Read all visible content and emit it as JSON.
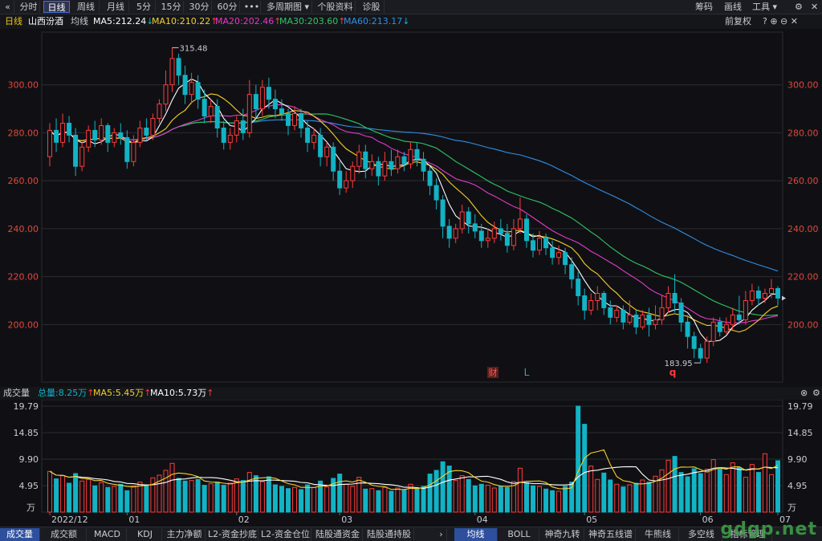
{
  "toolbar": {
    "back_icon": "«",
    "tabs": [
      "分时",
      "日线",
      "周线",
      "月线",
      "5分",
      "15分",
      "30分",
      "60分",
      "•••",
      "多周期图 ▾",
      "个股资料",
      "诊股"
    ],
    "active_tab": "日线",
    "right": [
      "筹码",
      "画线",
      "工具 ▾"
    ],
    "settings_icon": "⚙"
  },
  "info": {
    "period": "日线",
    "stock_name": "山西汾酒",
    "ma_label": "均线",
    "ma5": "MA5:212.24",
    "ma10": "MA10:210.22",
    "ma20": "MA20:202.46",
    "ma30": "MA30:203.60",
    "ma60": "MA60:213.17",
    "fuquan": "前复权",
    "ma5_arrow": "↓",
    "ma10_arrow": "↑",
    "ma20_arrow": "↑",
    "ma30_arrow": "↑",
    "ma60_arrow": "↓"
  },
  "volume_header": {
    "title": "成交量",
    "total": "总量:8.25万",
    "ma5": "MA5:5.45万",
    "ma10": "MA10:5.73万"
  },
  "bottom_tabs": {
    "left": [
      "成交量",
      "成交额",
      "MACD",
      "KDJ",
      "主力净额",
      "L2-资金抄底",
      "L2-资金仓位",
      "陆股通资金",
      "陆股通持股"
    ],
    "right": [
      "均线",
      "BOLL",
      "神奇九转",
      "神奇五线谱",
      "牛熊线",
      "多空线",
      "指标管理"
    ],
    "active_left": "成交量",
    "active_right": "均线"
  },
  "colors": {
    "up": "#ff3b3b",
    "down": "#12b3c4",
    "ma5": "#ffffff",
    "ma10": "#f5d02c",
    "ma20": "#e13bc8",
    "ma30": "#2ec764",
    "ma60": "#2f8fe6"
  },
  "markers": {
    "high_label": "315.48",
    "low_label": "183.95",
    "event_cai": "财",
    "event_l": "L",
    "event_q": "q"
  },
  "watermark": "gdgp.net",
  "chart_data": {
    "type": "candlestick",
    "title": "山西汾酒 日线",
    "price_axis": {
      "ticks": [
        200,
        220,
        240,
        260,
        280,
        300
      ],
      "tick_labels": [
        "200.00",
        "220.00",
        "240.00",
        "260.00",
        "280.00",
        "300.00"
      ],
      "ylim": [
        176,
        322
      ]
    },
    "date_axis": {
      "labels": [
        "2022/12",
        "01",
        "02",
        "03",
        "04",
        "05",
        "06",
        "07"
      ]
    },
    "volume_axis": {
      "unit": "万",
      "ticks": [
        4.95,
        9.9,
        14.85,
        19.79
      ],
      "tick_labels": [
        "4.95",
        "9.90",
        "14.85",
        "19.79"
      ],
      "ylim": [
        0,
        19.79
      ]
    },
    "candles": [
      [
        270,
        281,
        266,
        284
      ],
      [
        281,
        276,
        272,
        286
      ],
      [
        276,
        284,
        274,
        288
      ],
      [
        284,
        279,
        276,
        287
      ],
      [
        279,
        266,
        262,
        282
      ],
      [
        266,
        274,
        264,
        276
      ],
      [
        274,
        281,
        272,
        283
      ],
      [
        281,
        277,
        274,
        285
      ],
      [
        277,
        283,
        275,
        286
      ],
      [
        283,
        276,
        272,
        284
      ],
      [
        276,
        280,
        274,
        282
      ],
      [
        280,
        278,
        275,
        284
      ],
      [
        278,
        268,
        265,
        281
      ],
      [
        268,
        276,
        266,
        279
      ],
      [
        276,
        282,
        274,
        285
      ],
      [
        282,
        279,
        277,
        286
      ],
      [
        279,
        286,
        277,
        288
      ],
      [
        286,
        292,
        284,
        294
      ],
      [
        292,
        300,
        289,
        306
      ],
      [
        300,
        311,
        297,
        315.5
      ],
      [
        311,
        304,
        300,
        313
      ],
      [
        304,
        296,
        292,
        308
      ],
      [
        296,
        301,
        292,
        305
      ],
      [
        301,
        294,
        290,
        304
      ],
      [
        294,
        287,
        284,
        298
      ],
      [
        287,
        291,
        284,
        294
      ],
      [
        291,
        282,
        278,
        294
      ],
      [
        282,
        276,
        273,
        285
      ],
      [
        276,
        279,
        273,
        282
      ],
      [
        279,
        285,
        276,
        287
      ],
      [
        285,
        280,
        277,
        290
      ],
      [
        280,
        296,
        278,
        302
      ],
      [
        296,
        290,
        286,
        300
      ],
      [
        290,
        299,
        287,
        302
      ],
      [
        299,
        294,
        290,
        303
      ],
      [
        294,
        290,
        286,
        298
      ],
      [
        290,
        288,
        285,
        294
      ],
      [
        288,
        283,
        279,
        290
      ],
      [
        283,
        288,
        281,
        291
      ],
      [
        288,
        282,
        278,
        290
      ],
      [
        282,
        276,
        272,
        285
      ],
      [
        276,
        279,
        273,
        282
      ],
      [
        279,
        270,
        266,
        282
      ],
      [
        270,
        274,
        266,
        276
      ],
      [
        274,
        264,
        260,
        276
      ],
      [
        264,
        257,
        254,
        268
      ],
      [
        257,
        260,
        255,
        264
      ],
      [
        260,
        266,
        257,
        268
      ],
      [
        266,
        272,
        263,
        275
      ],
      [
        272,
        265,
        261,
        275
      ],
      [
        265,
        268,
        262,
        271
      ],
      [
        268,
        262,
        258,
        270
      ],
      [
        262,
        268,
        260,
        272
      ],
      [
        268,
        265,
        262,
        273
      ],
      [
        265,
        270,
        263,
        273
      ],
      [
        270,
        267,
        264,
        272
      ],
      [
        267,
        273,
        265,
        276
      ],
      [
        273,
        269,
        266,
        276
      ],
      [
        269,
        264,
        260,
        272
      ],
      [
        264,
        258,
        254,
        266
      ],
      [
        258,
        252,
        248,
        261
      ],
      [
        252,
        241,
        236,
        254
      ],
      [
        241,
        236,
        232,
        244
      ],
      [
        236,
        240,
        234,
        242
      ],
      [
        240,
        247,
        238,
        250
      ],
      [
        247,
        242,
        238,
        249
      ],
      [
        242,
        239,
        236,
        246
      ],
      [
        239,
        235,
        232,
        242
      ],
      [
        235,
        236,
        232,
        240
      ],
      [
        236,
        240,
        234,
        243
      ],
      [
        240,
        238,
        235,
        244
      ],
      [
        238,
        233,
        230,
        242
      ],
      [
        233,
        240,
        231,
        244
      ],
      [
        240,
        244,
        238,
        253
      ],
      [
        244,
        235,
        232,
        246
      ],
      [
        235,
        231,
        228,
        238
      ],
      [
        231,
        236,
        229,
        239
      ],
      [
        236,
        232,
        229,
        238
      ],
      [
        232,
        228,
        225,
        235
      ],
      [
        228,
        230,
        225,
        233
      ],
      [
        230,
        225,
        221,
        232
      ],
      [
        225,
        219,
        215,
        228
      ],
      [
        219,
        212,
        208,
        222
      ],
      [
        212,
        206,
        202,
        215
      ],
      [
        206,
        210,
        204,
        213
      ],
      [
        210,
        213,
        206,
        216
      ],
      [
        213,
        207,
        204,
        214
      ],
      [
        207,
        203,
        200,
        210
      ],
      [
        203,
        206,
        201,
        208
      ],
      [
        206,
        201,
        198,
        208
      ],
      [
        201,
        204,
        200,
        210
      ],
      [
        204,
        199,
        196,
        206
      ],
      [
        199,
        204,
        198,
        206
      ],
      [
        204,
        200,
        195,
        207
      ],
      [
        200,
        202,
        198,
        208
      ],
      [
        202,
        207,
        200,
        212
      ],
      [
        207,
        213,
        205,
        216
      ],
      [
        213,
        209,
        205,
        221
      ],
      [
        209,
        201,
        197,
        211
      ],
      [
        201,
        195,
        190,
        204
      ],
      [
        195,
        190,
        186,
        197
      ],
      [
        190,
        186,
        184,
        192
      ],
      [
        186,
        193,
        184,
        195
      ],
      [
        193,
        201,
        191,
        203
      ],
      [
        201,
        197,
        195,
        203
      ],
      [
        197,
        200,
        196,
        203
      ],
      [
        200,
        204,
        198,
        207
      ],
      [
        204,
        202,
        200,
        212
      ],
      [
        202,
        210,
        200,
        214
      ],
      [
        210,
        214,
        208,
        217
      ],
      [
        214,
        211,
        208,
        216
      ],
      [
        211,
        213,
        209,
        215
      ],
      [
        213,
        215,
        211,
        219
      ],
      [
        215,
        211,
        208,
        216
      ]
    ],
    "volumes": [
      7.6,
      6.2,
      6.8,
      5.4,
      7.2,
      5.8,
      6.1,
      4.9,
      5.5,
      4.6,
      4.8,
      5.2,
      4.0,
      4.9,
      5.6,
      5.1,
      6.4,
      6.9,
      7.8,
      9.1,
      6.3,
      5.8,
      5.9,
      6.1,
      5.0,
      5.3,
      5.6,
      5.0,
      5.4,
      6.2,
      5.9,
      7.4,
      6.8,
      5.7,
      6.6,
      5.1,
      4.8,
      4.4,
      4.6,
      4.2,
      5.1,
      4.6,
      5.8,
      4.7,
      6.3,
      7.1,
      5.2,
      4.8,
      6.5,
      4.3,
      4.4,
      4.0,
      4.6,
      3.9,
      4.5,
      4.1,
      5.2,
      4.3,
      4.8,
      7.1,
      7.8,
      9.4,
      8.6,
      5.9,
      6.8,
      6.1,
      4.9,
      5.2,
      5.0,
      4.5,
      4.8,
      4.6,
      5.7,
      8.2,
      5.5,
      4.9,
      4.8,
      4.3,
      4.0,
      3.9,
      4.8,
      5.6,
      19.79,
      16.4,
      8.6,
      6.1,
      7.3,
      6.0,
      5.2,
      4.7,
      5.1,
      5.4,
      6.0,
      5.6,
      6.7,
      7.9,
      9.7,
      10.4,
      7.4,
      6.6,
      8.1,
      7.2,
      8.0,
      9.8,
      8.1,
      7.0,
      9.2,
      8.3,
      6.5,
      8.9,
      7.4,
      10.9,
      7.0,
      9.6
    ],
    "ma_lines": [
      {
        "name": "MA5",
        "color_key": "ma5",
        "period": 5
      },
      {
        "name": "MA10",
        "color_key": "ma10",
        "period": 10
      },
      {
        "name": "MA20",
        "color_key": "ma20",
        "period": 20
      },
      {
        "name": "MA30",
        "color_key": "ma30",
        "period": 30
      },
      {
        "name": "MA60",
        "color_key": "ma60",
        "period": 60
      }
    ],
    "annotations": [
      {
        "text": "315.48",
        "type": "high",
        "value": 315.48
      },
      {
        "text": "183.95",
        "type": "low",
        "value": 183.95
      }
    ]
  }
}
